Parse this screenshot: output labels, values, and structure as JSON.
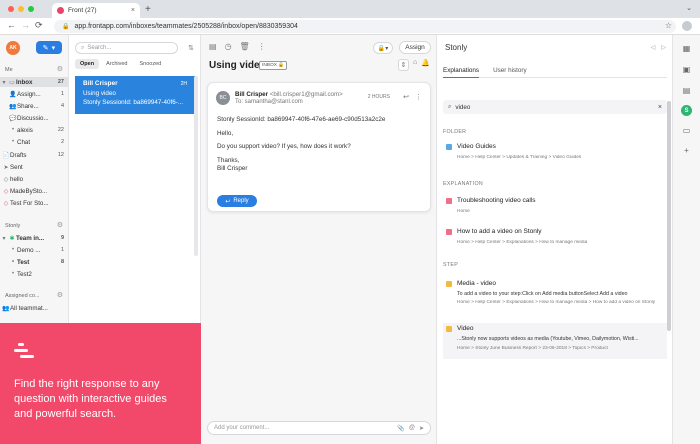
{
  "browser": {
    "tab_title": "Front (27)",
    "tab_close": "×",
    "new_tab": "+",
    "url": "app.frontapp.com/inboxes/teammates/2505288/inbox/open/8830359304",
    "back": "←",
    "forward": "→",
    "reload": "⟳"
  },
  "nav": {
    "avatar": "AK",
    "me_header": "Me",
    "items": [
      {
        "label": "Inbox",
        "count": "27"
      },
      {
        "label": "Assign...",
        "count": "1"
      },
      {
        "label": "Share...",
        "count": "4"
      },
      {
        "label": "Discussio...",
        "count": ""
      },
      {
        "label": "alexis",
        "count": "22"
      },
      {
        "label": "Chat",
        "count": "2"
      },
      {
        "label": "Drafts",
        "count": "12"
      },
      {
        "label": "Sent",
        "count": ""
      },
      {
        "label": "hello",
        "count": ""
      },
      {
        "label": "MadeBySto...",
        "count": ""
      },
      {
        "label": "Test For Sto...",
        "count": ""
      }
    ],
    "stonly_header": "Stonly",
    "stonly_items": [
      {
        "label": "Team in...",
        "count": "9"
      },
      {
        "label": "Demo ...",
        "count": "1"
      },
      {
        "label": "Test",
        "count": "8"
      },
      {
        "label": "Test2",
        "count": ""
      }
    ],
    "assigned_header": "Assigned co...",
    "assigned_items": [
      {
        "label": "All teammat...",
        "count": ""
      }
    ]
  },
  "list": {
    "search_placeholder": "Search...",
    "filters": [
      "Open",
      "Archived",
      "Snoozed"
    ],
    "message": {
      "from": "Bill Crisper",
      "time": "2H",
      "subject": "Using video",
      "snippet": "Stonly SessionId: ba869947-40f6-..."
    }
  },
  "promo": {
    "text": "Find the right response to any question with interactive guides and powerful search."
  },
  "conversation": {
    "assign_label": "Assign",
    "subject": "Using video",
    "inbox_tag": "INBOX 🔒",
    "message": {
      "avatar": "BC",
      "from_name": "Bill Crisper",
      "from_email": "<bill.crisper1@gmail.com>",
      "to": "To: samantha@stanl.com",
      "time": "2 HOURS",
      "body": [
        "Stonly SessionId: ba869947-40f6-47e6-ae69-c90d513a2c2e",
        "Hello,",
        "Do you support video? If yes, how does it work?",
        "Thanks,",
        "Bill Crisper"
      ],
      "reply_label": "Reply"
    },
    "comment_placeholder": "Add your comment..."
  },
  "stonly": {
    "title": "Stonly",
    "tabs": [
      "Explanations",
      "User history"
    ],
    "search_value": "video",
    "sections": {
      "folder": "FOLDER",
      "explanation": "EXPLANATION",
      "step": "STEP"
    },
    "results": {
      "folder": [
        {
          "title": "Video Guides",
          "path": "Home > Help Center > Updates & Training > Video Guides"
        }
      ],
      "explanation": [
        {
          "title": "Troubleshooting video calls",
          "path": "Home"
        },
        {
          "title": "How to add a video on Stonly",
          "path": "Home > Help Center > Explanations > How to manage media"
        }
      ],
      "step": [
        {
          "title": "Media - video",
          "line": "To add a video to your step:Click on Add media buttonSelect Add a video",
          "path": "Home > Help Center > Explanations > How to manage media > How to add a video on Stonly"
        },
        {
          "title": "Video",
          "line": "...Stonly now supports videos as media (Youtube, Vimeo, Dailymotion, Wisti...",
          "path": "Home > Stonly June Business Report > 23-06-2018 > Topics > Product"
        }
      ]
    }
  },
  "colors": {
    "accent": "#2a7de1",
    "promo": "#f2496b",
    "folder_icon": "#5aa9e6",
    "explanation_icon": "#ef6f86",
    "step_icon": "#f5b942",
    "stonly_badge": "#2bb673"
  }
}
